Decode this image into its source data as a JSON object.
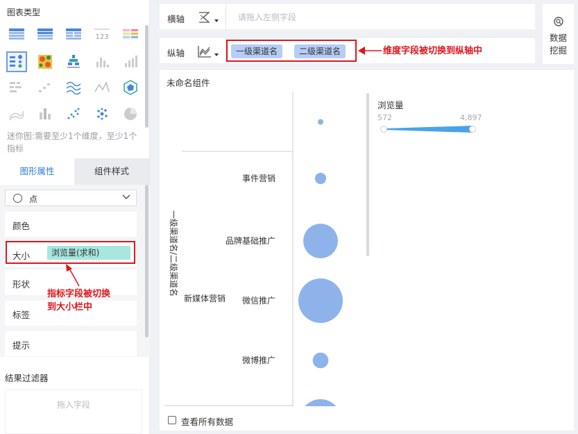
{
  "sidebar": {
    "chart_types_title": "图表类型",
    "hint": "迷你图:需要至少1个维度，至少1个指标",
    "tabs": [
      "图形属性",
      "组件样式"
    ],
    "mark_type": "点",
    "props": {
      "color": "颜色",
      "size": "大小",
      "size_field": "浏览量(求和)",
      "shape": "形状",
      "label": "标签",
      "tooltip": "提示"
    },
    "filter_title": "结果过滤器",
    "drop_placeholder": "拖入字段",
    "annotation": "指标字段被切换到大小栏中",
    "icons": [
      "table-icon",
      "cross-table-icon",
      "detail-table-icon",
      "kpi-number-icon",
      "color-table-icon",
      "scatter-table-icon",
      "heatmap-icon",
      "dot-grid-icon",
      "bar-icon",
      "bar2-icon",
      "bar-grid-icon",
      "step-icon",
      "wave-line-icon",
      "radar-line-icon",
      "gauge-icon",
      "area-icon",
      "stacked-bar-icon",
      "scatter-icon",
      "bubble-cluster-icon",
      "pie-icon"
    ]
  },
  "axes": {
    "x_label": "横轴",
    "x_placeholder": "请拖入左侧字段",
    "y_label": "纵轴",
    "y_fields": [
      "一级渠道名",
      "二级渠道名"
    ],
    "annotation": "维度字段被切换到纵轴中"
  },
  "mining": {
    "line1": "数据",
    "line2": "挖掘"
  },
  "component": {
    "title": "未命名组件",
    "show_all": "查看所有数据"
  },
  "chart_data": {
    "type": "scatter",
    "axis_title": "一级渠道名/二级渠道名",
    "size_legend": {
      "title": "浏览量",
      "min": "572",
      "max": "4,897"
    },
    "groups": [
      {
        "name": "",
        "rows": [
          {
            "label": "",
            "size": 572
          }
        ]
      },
      {
        "name": "新媒体营销",
        "rows": [
          {
            "label": "事件营销",
            "size": 1200
          },
          {
            "label": "品牌基础推广",
            "size": 3800
          },
          {
            "label": "微信推广",
            "size": 4897
          },
          {
            "label": "微博推广",
            "size": 1700
          },
          {
            "label": "",
            "size": 4600
          }
        ]
      }
    ]
  },
  "colors": {
    "accent": "#2f7bd9",
    "bubble": "#8db3ea",
    "annotation": "#e0141b",
    "chip": "#b6cdf5",
    "pill": "#a8e6df"
  }
}
